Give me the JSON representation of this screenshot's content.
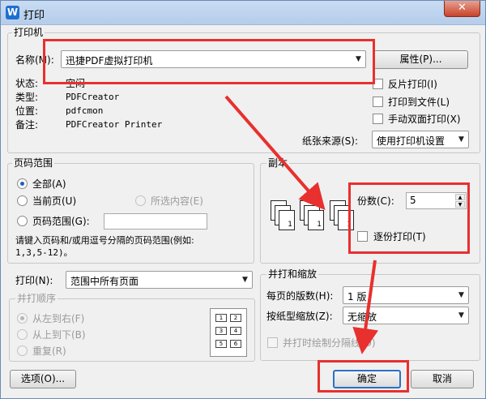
{
  "window": {
    "title": "打印",
    "app_icon": "W",
    "close": "✕"
  },
  "printer": {
    "group_title": "打印机",
    "name_label": "名称(M):",
    "name_value": "迅捷PDF虚拟打印机",
    "properties_button": "属性(P)...",
    "status_label": "状态:",
    "status_value": "空闲",
    "type_label": "类型:",
    "type_value": "PDFCreator",
    "location_label": "位置:",
    "location_value": "pdfcmon",
    "comment_label": "备注:",
    "comment_value": "PDFCreator Printer",
    "reverse_print": "反片打印(I)",
    "print_to_file": "打印到文件(L)",
    "manual_duplex": "手动双面打印(X)",
    "paper_source_label": "纸张来源(S):",
    "paper_source_value": "使用打印机设置"
  },
  "page_range": {
    "group_title": "页码范围",
    "all": "全部(A)",
    "current_page": "当前页(U)",
    "selection": "所选内容(E)",
    "pages": "页码范围(G):",
    "pages_value": "",
    "hint": "请键入页码和/或用逗号分隔的页码范围(例如:",
    "hint_example": "1,3,5-12)。"
  },
  "copies": {
    "group_title": "副本",
    "count_label": "份数(C):",
    "count_value": "5",
    "collate": "逐份打印(T)",
    "stack_a": [
      "3",
      "2",
      "1"
    ],
    "stack_b": [
      "3",
      "2",
      "1"
    ]
  },
  "print_what": {
    "label": "打印(N):",
    "value": "范围中所有页面",
    "order_title": "并打顺序",
    "left_to_right": "从左到右(F)",
    "top_to_bottom": "从上到下(B)",
    "repeat": "重复(R)",
    "thumbnail_numbers": [
      "1",
      "2",
      "3",
      "4",
      "5",
      "6"
    ]
  },
  "zoom": {
    "group_title": "并打和缩放",
    "pages_per_sheet_label": "每页的版数(H):",
    "pages_per_sheet_value": "1 版",
    "scale_label": "按纸型缩放(Z):",
    "scale_value": "无缩放",
    "draw_borders": "并打时绘制分隔线(D)"
  },
  "buttons": {
    "options": "选项(O)...",
    "ok": "确定",
    "cancel": "取消"
  },
  "colors": {
    "highlight": "#e8302e",
    "accent": "#1d5fbf"
  }
}
